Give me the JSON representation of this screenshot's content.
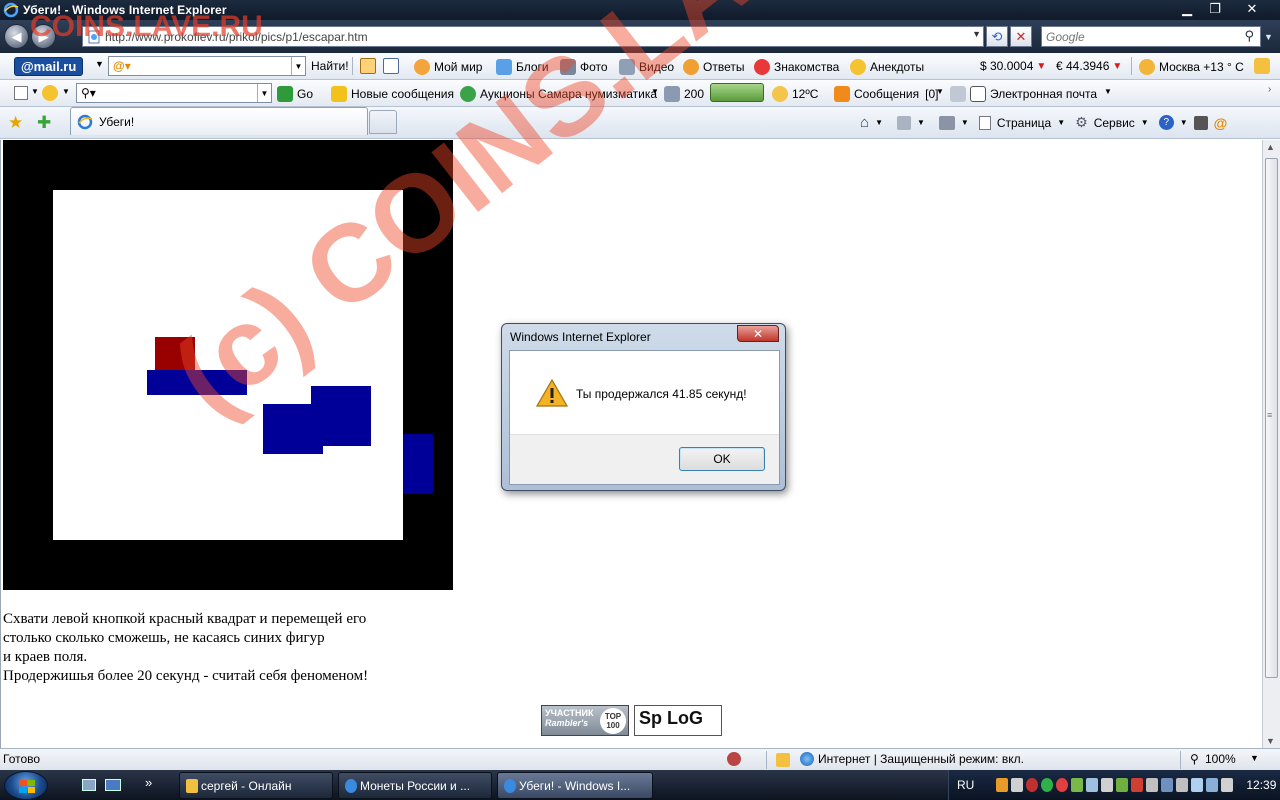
{
  "window": {
    "title": "Убеги! - Windows Internet Explorer",
    "minimize": "▁",
    "maximize": "❐",
    "close": "✕"
  },
  "address_bar": {
    "url": "http://www.prokofiev.ru/prikol/pics/p1/escapar.htm",
    "search_placeholder": "Google"
  },
  "mailru_toolbar": {
    "logo": "@mail.ru",
    "find_button": "Найти!",
    "links": [
      "Мой мир",
      "Блоги",
      "Фото",
      "Видео",
      "Ответы",
      "Знакомства",
      "Анекдоты"
    ],
    "usd": "$ 30.0004",
    "eur": "€ 44.3946",
    "weather": "Москва +13 ° C"
  },
  "second_toolbar": {
    "go": "Go",
    "new_messages": "Новые сообщения",
    "auctions": "Аукционы Самара нумизматика",
    "count": "200",
    "temp": "12ºC",
    "messages": "Сообщения",
    "messages_count": "[0]",
    "email": "Электронная почта"
  },
  "tabs": {
    "active_label": "Убеги!"
  },
  "command_bar": {
    "page": "Страница",
    "tools": "Сервис"
  },
  "page": {
    "instructions": [
      "Схвати левой кнопкой красный квадрат и перемещей его",
      "столько сколько сможешь, не касаясь синих фигур",
      "и краев поля.",
      "Продержишья более 20 секунд - считай себя феноменом!"
    ],
    "badge_rambler_line1": "УЧАСТНИК",
    "badge_rambler_line2": "Rambler's",
    "badge_top": "TOP",
    "badge_100": "100",
    "badge_splog": "Sp LoG"
  },
  "colors": {
    "red_square": "#990000",
    "blue_block": "#000099",
    "field_border": "#000000"
  },
  "dialog": {
    "title": "Windows Internet Explorer",
    "message": "Ты продержался 41.85 секунд!",
    "ok": "OK",
    "close": "✕"
  },
  "statusbar": {
    "status": "Готово",
    "zone": "Интернет | Защищенный режим: вкл.",
    "zoom": "100%"
  },
  "taskbar": {
    "buttons": [
      "сергей - Онлайн",
      "Монеты России и ...",
      "Убеги! - Windows I..."
    ],
    "language": "RU",
    "clock": "12:39",
    "more": "»"
  },
  "watermark": {
    "top": "COINS.LAVE.RU",
    "diagonal": "(c) COINS.LAVE.RU"
  }
}
